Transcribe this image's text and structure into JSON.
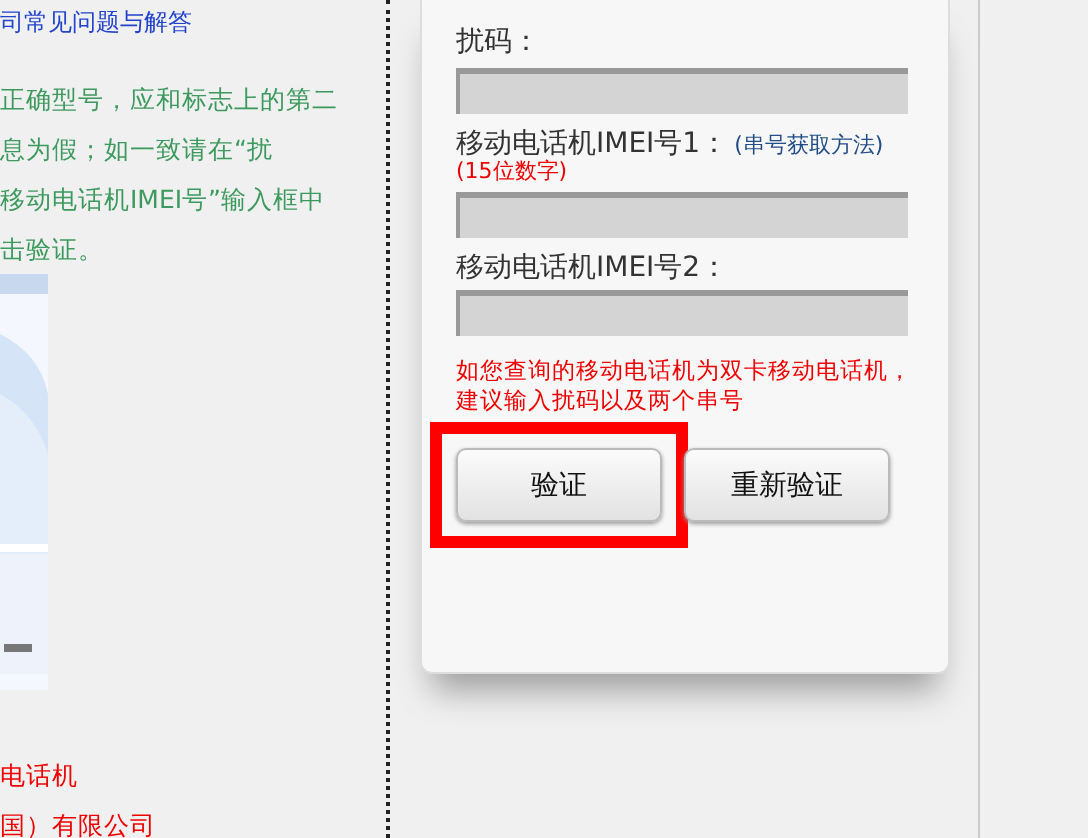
{
  "left": {
    "link": "司常见问题与解答",
    "paragraph_lines": [
      "正确型号，应和标志上的第二",
      "息为假；如一致请在“扰",
      "移动电话机IMEI号”输入框中",
      "击验证。"
    ],
    "picture": {
      "kind": "picture"
    },
    "footer_lines": [
      "电话机",
      "国）有限公司"
    ]
  },
  "form": {
    "fields": [
      {
        "label": "扰码："
      },
      {
        "label": "移动电话机IMEI号1：",
        "link": "(串号获取方法)",
        "hint": "(15位数字)"
      },
      {
        "label": "移动电话机IMEI号2："
      }
    ],
    "note": "如您查询的移动电话机为双卡移动电话机，建议输入扰码以及两个串号",
    "buttons": [
      {
        "label": "验证",
        "highlighted": true
      },
      {
        "label": "重新验证",
        "highlighted": false
      }
    ]
  }
}
